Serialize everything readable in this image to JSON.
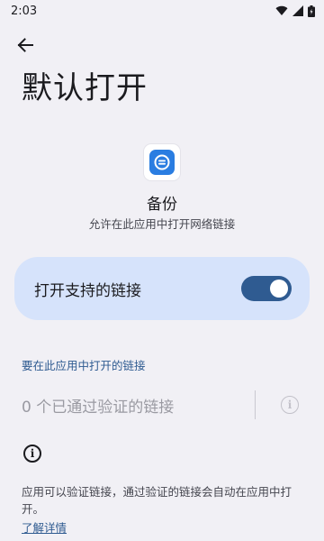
{
  "status_bar": {
    "time": "2:03",
    "icons": [
      "wifi-icon",
      "signal-icon",
      "battery-icon"
    ]
  },
  "header": {
    "back_icon": "arrow-back-icon",
    "title": "默认打开"
  },
  "app": {
    "icon": "app-logo-icon",
    "name": "备份",
    "subtitle": "允许在此应用中打开网络链接"
  },
  "toggle": {
    "label": "打开支持的链接",
    "checked": true
  },
  "links_section": {
    "header": "要在此应用中打开的链接",
    "count_text": "0 个已通过验证的链接",
    "info_icon": "info-icon"
  },
  "footer": {
    "info_icon": "info-icon",
    "text": "应用可以验证链接，通过验证的链接会自动在应用中打开。",
    "link": "了解详情"
  },
  "colors": {
    "background": "#f1f0f5",
    "card": "#d6e3fb",
    "accent": "#2f5b91",
    "app_icon_blue": "#2a7de1"
  }
}
